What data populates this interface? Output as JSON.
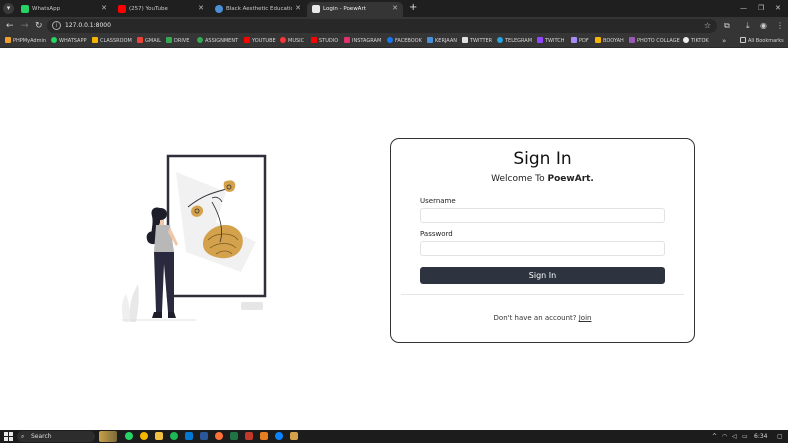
{
  "tabs": [
    {
      "title": "WhatsApp",
      "icon": "whatsapp-icon",
      "color": "#25d366"
    },
    {
      "title": "(257) YouTube",
      "icon": "youtube-icon",
      "color": "#ff0000"
    },
    {
      "title": "Black Aesthetic Education On...",
      "icon": "globe-icon",
      "color": "#4a90d9"
    },
    {
      "title": "Login - PoewArt",
      "icon": "page-icon",
      "color": "#dddddd",
      "active": true
    }
  ],
  "address": {
    "url": "127.0.0.1:8000"
  },
  "bookmarks": [
    {
      "label": "PHPMyAdmin",
      "color": "#f0a030"
    },
    {
      "label": "WHATSAPP",
      "color": "#25d366"
    },
    {
      "label": "CLASSROOM",
      "color": "#f4b400"
    },
    {
      "label": "GMAIL",
      "color": "#ea4335"
    },
    {
      "label": "DRIVE",
      "color": "#34a853"
    },
    {
      "label": "ASSIGNMENT",
      "color": "#34a853"
    },
    {
      "label": "YOUTUBE",
      "color": "#ff0000"
    },
    {
      "label": "MUSIC",
      "color": "#ff3333"
    },
    {
      "label": "STUDIO",
      "color": "#ff0000"
    },
    {
      "label": "INSTAGRAM",
      "color": "#e1306c"
    },
    {
      "label": "FACEBOOK",
      "color": "#1877f2"
    },
    {
      "label": "KERJAAN",
      "color": "#4a90d9"
    },
    {
      "label": "TWITTER",
      "color": "#e0e0e0"
    },
    {
      "label": "TELEGRAM",
      "color": "#2aa3e0"
    },
    {
      "label": "TWITCH",
      "color": "#9146ff"
    },
    {
      "label": "PDF",
      "color": "#a78bfa"
    },
    {
      "label": "BOOYAH",
      "color": "#f4b400"
    },
    {
      "label": "PHOTO COLLAGE",
      "color": "#9b59b6"
    },
    {
      "label": "TIKTOK",
      "color": "#eeeeee"
    }
  ],
  "bookmarks_more": "»",
  "all_bookmarks": "All Bookmarks",
  "login": {
    "title": "Sign In",
    "welcome_prefix": "Welcome To",
    "brand": "PoewArt.",
    "username_label": "Username",
    "username_value": "",
    "password_label": "Password",
    "password_value": "",
    "submit_label": "Sign In",
    "signup_prompt": "Don't have an account?",
    "signup_link": "Join"
  },
  "taskbar": {
    "search_label": "Search",
    "time": "6:34"
  },
  "colors": {
    "accent_button": "#2d3440",
    "illustration_accent": "#d4a24c"
  }
}
